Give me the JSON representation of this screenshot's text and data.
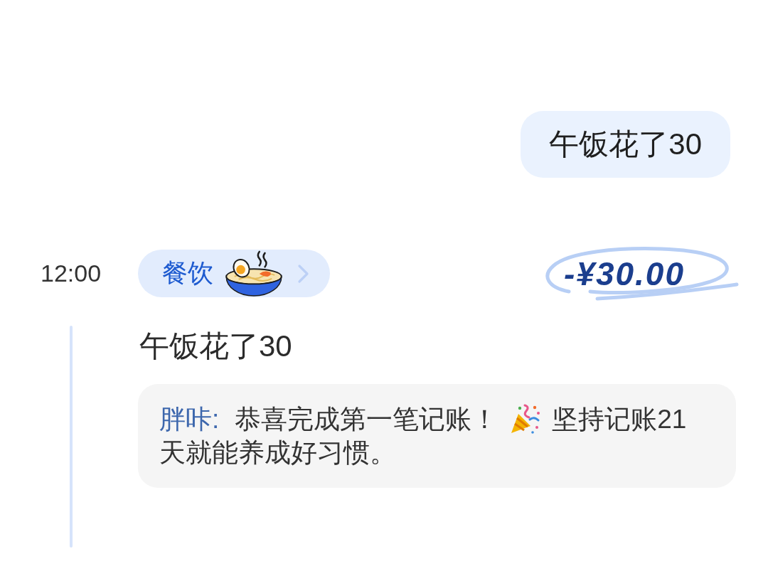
{
  "user_message": {
    "text": "午饭花了30"
  },
  "entry": {
    "time": "12:00",
    "category": {
      "label": "餐饮"
    },
    "amount": "-¥30.00",
    "note": "午饭花了30",
    "comment": {
      "author": "胖咔:",
      "segments": [
        {
          "kind": "text",
          "text": "恭喜完成第一笔记账！"
        },
        {
          "kind": "emoji"
        },
        {
          "kind": "text",
          "text": "坚持记账21天就能养成好习惯。"
        }
      ]
    }
  }
}
